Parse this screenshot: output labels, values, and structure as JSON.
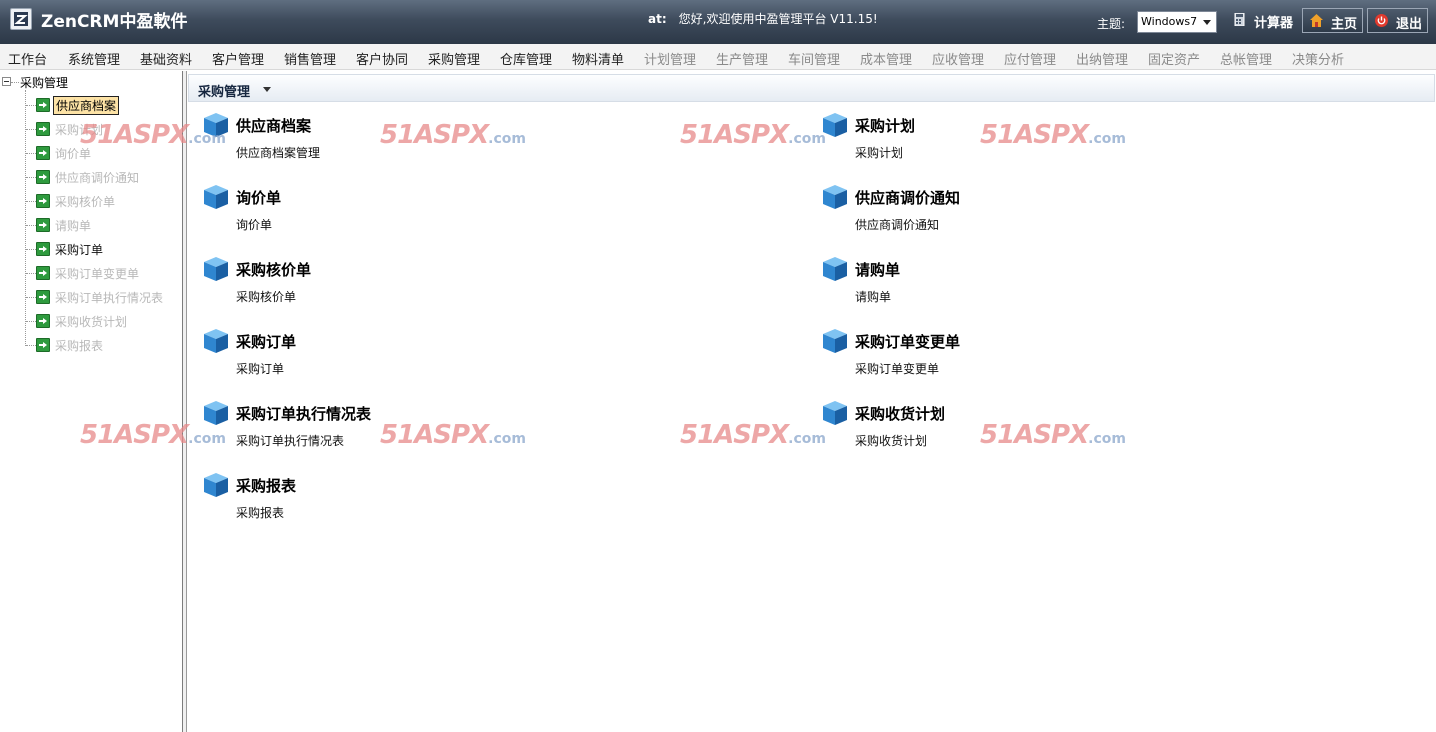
{
  "header": {
    "app_title": "ZenCRM中盈軟件",
    "welcome_prefix": "at:",
    "welcome_text": "您好,欢迎使用中盈管理平台 V11.15!",
    "theme_label": "主题:",
    "theme_value": "Windows7",
    "calc_label": "计算器",
    "home_label": "主页",
    "exit_label": "退出"
  },
  "menu": [
    {
      "label": "工作台",
      "enabled": true
    },
    {
      "label": "系统管理",
      "enabled": true
    },
    {
      "label": "基础资料",
      "enabled": true
    },
    {
      "label": "客户管理",
      "enabled": true
    },
    {
      "label": "销售管理",
      "enabled": true
    },
    {
      "label": "客户协同",
      "enabled": true
    },
    {
      "label": "采购管理",
      "enabled": true
    },
    {
      "label": "仓库管理",
      "enabled": true
    },
    {
      "label": "物料清单",
      "enabled": true
    },
    {
      "label": "计划管理",
      "enabled": false
    },
    {
      "label": "生产管理",
      "enabled": false
    },
    {
      "label": "车间管理",
      "enabled": false
    },
    {
      "label": "成本管理",
      "enabled": false
    },
    {
      "label": "应收管理",
      "enabled": false
    },
    {
      "label": "应付管理",
      "enabled": false
    },
    {
      "label": "出纳管理",
      "enabled": false
    },
    {
      "label": "固定资产",
      "enabled": false
    },
    {
      "label": "总帐管理",
      "enabled": false
    },
    {
      "label": "决策分析",
      "enabled": false
    }
  ],
  "tree": {
    "root": "采购管理",
    "items": [
      {
        "label": "供应商档案",
        "state": "selected"
      },
      {
        "label": "采购计划",
        "state": "disabled"
      },
      {
        "label": "询价单",
        "state": "disabled"
      },
      {
        "label": "供应商调价通知",
        "state": "disabled"
      },
      {
        "label": "采购核价单",
        "state": "disabled"
      },
      {
        "label": "请购单",
        "state": "disabled"
      },
      {
        "label": "采购订单",
        "state": "enabled"
      },
      {
        "label": "采购订单变更单",
        "state": "disabled"
      },
      {
        "label": "采购订单执行情况表",
        "state": "disabled"
      },
      {
        "label": "采购收货计划",
        "state": "disabled"
      },
      {
        "label": "采购报表",
        "state": "disabled"
      }
    ]
  },
  "main": {
    "breadcrumb": "采购管理",
    "modules": [
      {
        "title": "供应商档案",
        "desc": "供应商档案管理"
      },
      {
        "title": "采购计划",
        "desc": "采购计划"
      },
      {
        "title": "询价单",
        "desc": "询价单"
      },
      {
        "title": "供应商调价通知",
        "desc": "供应商调价通知"
      },
      {
        "title": "采购核价单",
        "desc": "采购核价单"
      },
      {
        "title": "请购单",
        "desc": "请购单"
      },
      {
        "title": "采购订单",
        "desc": "采购订单"
      },
      {
        "title": "采购订单变更单",
        "desc": "采购订单变更单"
      },
      {
        "title": "采购订单执行情况表",
        "desc": "采购订单执行情况表"
      },
      {
        "title": "采购收货计划",
        "desc": "采购收货计划"
      },
      {
        "title": "采购报表",
        "desc": "采购报表"
      }
    ]
  },
  "watermark": {
    "main": "51ASPX",
    "suffix": ".com"
  }
}
